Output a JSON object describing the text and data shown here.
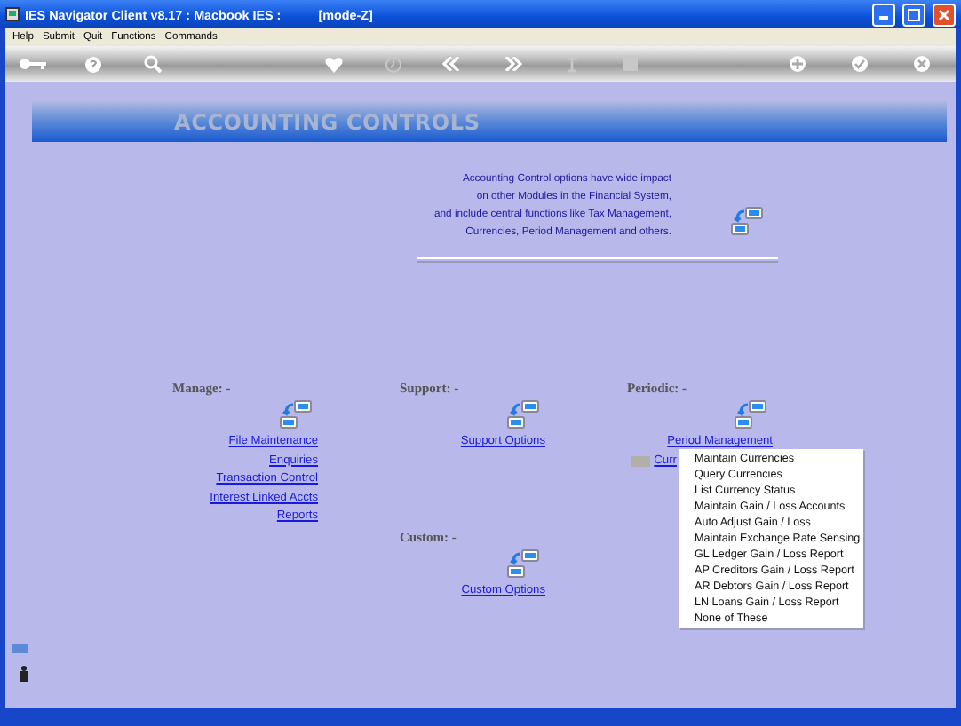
{
  "window": {
    "title": "IES Navigator Client v8.17 : Macbook IES :",
    "mode": "[mode-Z]"
  },
  "menu": [
    "Help",
    "Submit",
    "Quit",
    "Functions",
    "Commands"
  ],
  "header": {
    "title": "ACCOUNTING CONTROLS"
  },
  "description": [
    "Accounting Control options have wide impact",
    "on other Modules in the Financial System,",
    "and include central functions like Tax Management,",
    "Currencies, Period Management and others."
  ],
  "sections": [
    {
      "title": "Manage: -",
      "links": [
        {
          "label": "File Maintenance",
          "highlighted": false
        },
        {
          "label": "Enquiries",
          "highlighted": false
        },
        {
          "label": "Transaction Control",
          "highlighted": false
        },
        {
          "label": "Interest Linked Accts",
          "highlighted": false
        },
        {
          "label": "Reports",
          "highlighted": false
        }
      ]
    },
    {
      "title": "Support: -",
      "links": [
        {
          "label": "Support Options",
          "highlighted": false
        }
      ]
    },
    {
      "title": "Periodic: -",
      "links": [
        {
          "label": "Period Management",
          "highlighted": false
        },
        {
          "label": "Curr",
          "highlighted": true
        }
      ]
    },
    {
      "title": "Custom: -",
      "links": [
        {
          "label": "Custom Options",
          "highlighted": false
        }
      ]
    }
  ],
  "popup_menu": [
    "Maintain Currencies",
    "Query Currencies",
    "List Currency Status",
    "Maintain Gain / Loss Accounts",
    "Auto Adjust Gain / Loss",
    "Maintain Exchange Rate Sensing",
    "GL Ledger Gain / Loss Report",
    "AP Creditors Gain / Loss Report",
    "AR Debtors Gain / Loss Report",
    "LN Loans Gain / Loss Report",
    "None of These"
  ]
}
